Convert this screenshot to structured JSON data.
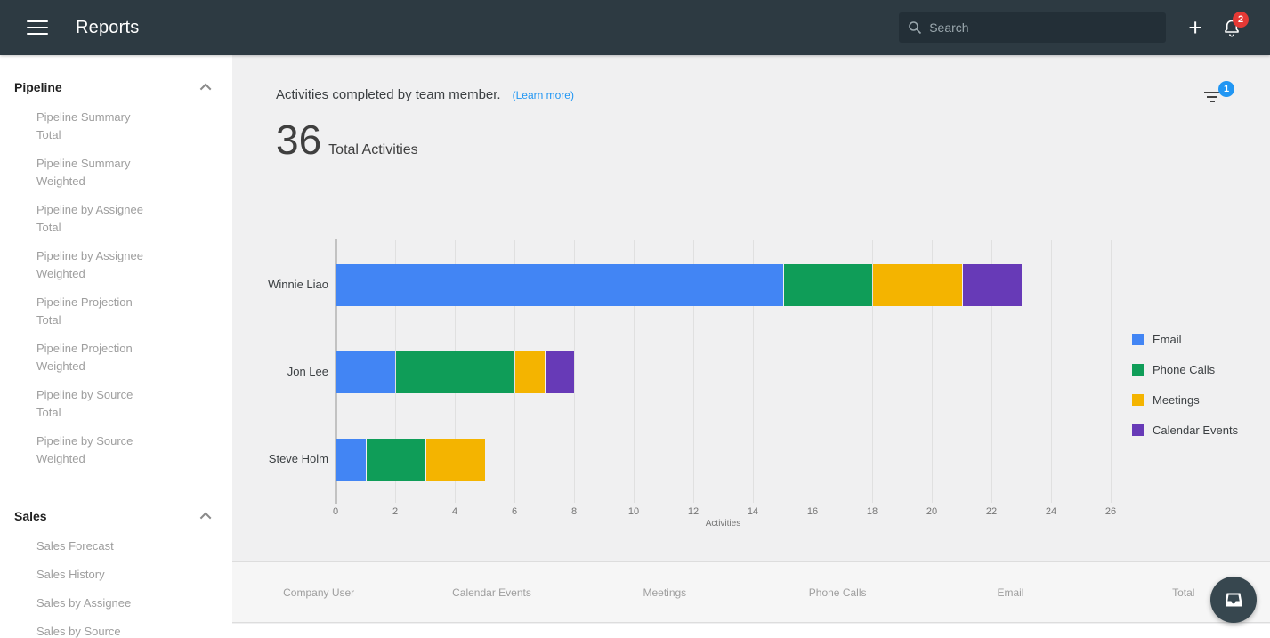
{
  "header": {
    "title": "Reports",
    "search_placeholder": "Search",
    "notification_count": "2"
  },
  "sidebar": {
    "sections": [
      {
        "label": "Pipeline",
        "items": [
          "Pipeline Summary Total",
          "Pipeline Summary Weighted",
          "Pipeline by Assignee Total",
          "Pipeline by Assignee Weighted",
          "Pipeline Projection Total",
          "Pipeline Projection Weighted",
          "Pipeline by Source Total",
          "Pipeline by Source Weighted"
        ]
      },
      {
        "label": "Sales",
        "items": [
          "Sales Forecast",
          "Sales History",
          "Sales by Assignee",
          "Sales by Source"
        ]
      }
    ]
  },
  "report": {
    "title": "Activities completed by team member.",
    "learn_more": "(Learn more)",
    "filter_badge": "1",
    "total_value": "36",
    "total_label": "Total Activities"
  },
  "chart_data": {
    "type": "bar",
    "orientation": "horizontal",
    "stacked": true,
    "categories": [
      "Winnie Liao",
      "Jon Lee",
      "Steve Holm"
    ],
    "series": [
      {
        "name": "Email",
        "color": "#4285f4",
        "values": [
          15,
          2,
          1
        ]
      },
      {
        "name": "Phone Calls",
        "color": "#0f9d58",
        "values": [
          3,
          4,
          2
        ]
      },
      {
        "name": "Meetings",
        "color": "#f4b400",
        "values": [
          3,
          1,
          2
        ]
      },
      {
        "name": "Calendar Events",
        "color": "#673ab7",
        "values": [
          2,
          1,
          0
        ]
      }
    ],
    "category_totals": [
      23,
      8,
      5
    ],
    "total": 36,
    "xlabel": "Activities",
    "xlim": [
      0,
      27
    ],
    "xticks": [
      0,
      2,
      4,
      6,
      8,
      10,
      12,
      14,
      16,
      18,
      20,
      22,
      24,
      26
    ],
    "grid": true,
    "legend_position": "right"
  },
  "table": {
    "columns": [
      "Company User",
      "Calendar Events",
      "Meetings",
      "Phone Calls",
      "Email",
      "Total"
    ]
  },
  "colors": {
    "appbar_bg": "#2d3a42",
    "search_bg": "#232f37",
    "notification_badge": "#e53935",
    "filter_badge": "#2196f3",
    "link": "#2196f3",
    "main_bg": "#f0f0f1"
  }
}
